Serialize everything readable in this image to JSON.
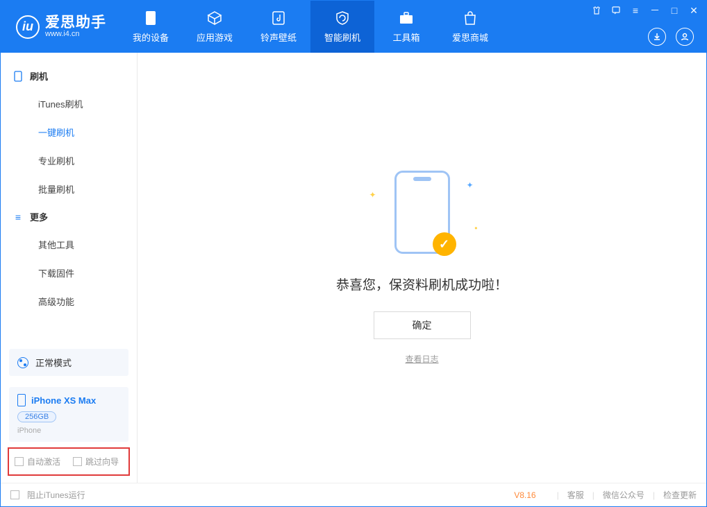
{
  "app": {
    "title": "爱思助手",
    "subtitle": "www.i4.cn"
  },
  "tabs": {
    "items": [
      {
        "label": "我的设备"
      },
      {
        "label": "应用游戏"
      },
      {
        "label": "铃声壁纸"
      },
      {
        "label": "智能刷机"
      },
      {
        "label": "工具箱"
      },
      {
        "label": "爱思商城"
      }
    ]
  },
  "sidebar": {
    "section1": {
      "title": "刷机"
    },
    "items1": [
      {
        "label": "iTunes刷机"
      },
      {
        "label": "一键刷机"
      },
      {
        "label": "专业刷机"
      },
      {
        "label": "批量刷机"
      }
    ],
    "section2": {
      "title": "更多"
    },
    "items2": [
      {
        "label": "其他工具"
      },
      {
        "label": "下载固件"
      },
      {
        "label": "高级功能"
      }
    ]
  },
  "device": {
    "mode_label": "正常模式",
    "name": "iPhone XS Max",
    "capacity": "256GB",
    "type": "iPhone"
  },
  "options": {
    "auto_activate": "自动激活",
    "skip_wizard": "跳过向导"
  },
  "main": {
    "success_text": "恭喜您，保资料刷机成功啦！",
    "confirm": "确定",
    "view_log": "查看日志"
  },
  "footer": {
    "block_itunes": "阻止iTunes运行",
    "version": "V8.16",
    "links": {
      "service": "客服",
      "wechat": "微信公众号",
      "check_update": "检查更新"
    }
  }
}
